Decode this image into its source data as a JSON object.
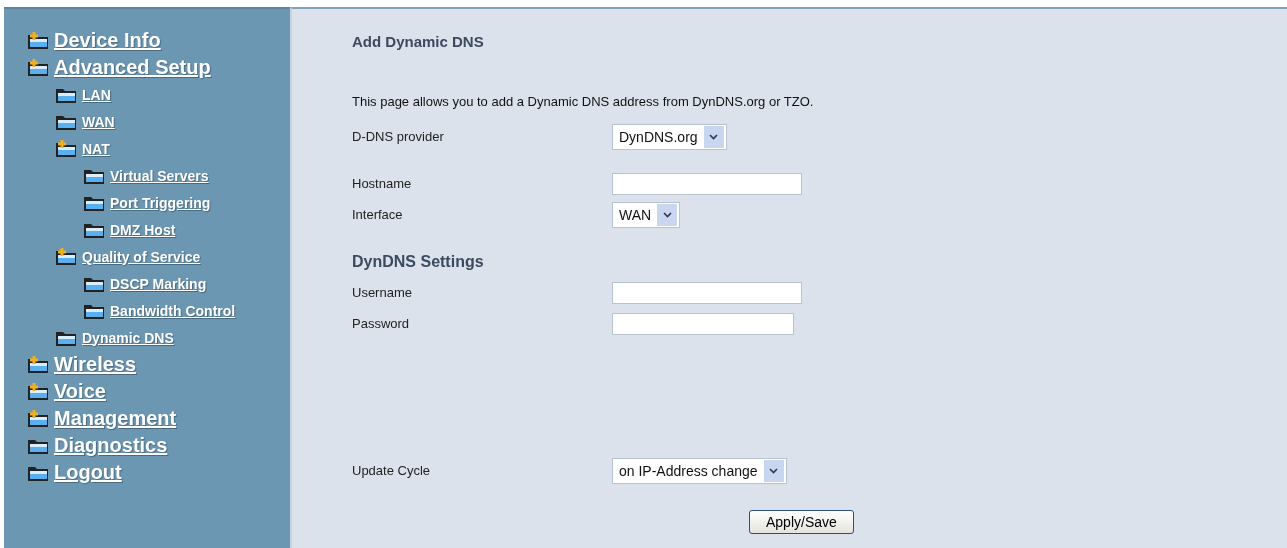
{
  "sidebar": {
    "items": [
      {
        "label": "Device Info",
        "kind": "folder-plus"
      },
      {
        "label": "Advanced Setup",
        "kind": "folder-plus",
        "children": [
          {
            "label": "LAN",
            "kind": "folder"
          },
          {
            "label": "WAN",
            "kind": "folder"
          },
          {
            "label": "NAT",
            "kind": "folder-plus",
            "children": [
              {
                "label": "Virtual Servers",
                "kind": "folder"
              },
              {
                "label": "Port Triggering",
                "kind": "folder"
              },
              {
                "label": "DMZ Host",
                "kind": "folder"
              }
            ]
          },
          {
            "label": "Quality of Service",
            "kind": "folder-plus",
            "children": [
              {
                "label": "DSCP Marking",
                "kind": "folder"
              },
              {
                "label": "Bandwidth Control",
                "kind": "folder"
              }
            ]
          },
          {
            "label": "Dynamic DNS",
            "kind": "folder"
          }
        ]
      },
      {
        "label": "Wireless",
        "kind": "folder-plus"
      },
      {
        "label": "Voice",
        "kind": "folder-plus"
      },
      {
        "label": "Management",
        "kind": "folder-plus"
      },
      {
        "label": "Diagnostics",
        "kind": "folder"
      },
      {
        "label": "Logout",
        "kind": "folder"
      }
    ]
  },
  "main": {
    "title": "Add Dynamic DNS",
    "description": "This page allows you to add a Dynamic DNS address from DynDNS.org or TZO.",
    "fields": [
      {
        "kind": "select",
        "label": "D-DNS provider",
        "value": "DynDNS.org"
      },
      {
        "kind": "text",
        "label": "Hostname"
      },
      {
        "kind": "select",
        "label": "Interface",
        "value": "WAN"
      },
      {
        "kind": "heading",
        "label": "DynDNS Settings"
      },
      {
        "kind": "text",
        "label": "Username"
      },
      {
        "kind": "password",
        "label": "Password"
      },
      {
        "kind": "select",
        "label": "Update Cycle",
        "value": "on IP-Address change"
      }
    ],
    "button": "Apply/Save"
  }
}
